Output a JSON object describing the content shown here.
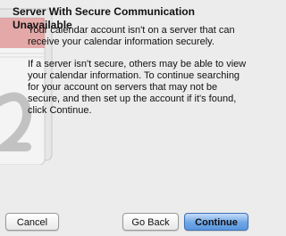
{
  "dialog": {
    "title": "Server With Secure Communication Unavailable",
    "paragraph1": "Your calendar account isn't on a server that can receive your calendar information securely.",
    "paragraph2": "If a server isn't secure, others may be able to view your calendar information. To continue searching for your account on servers that may not be secure, and then set up the account if it's found, click Continue."
  },
  "buttons": {
    "cancel": "Cancel",
    "go_back": "Go Back",
    "continue": "Continue"
  }
}
